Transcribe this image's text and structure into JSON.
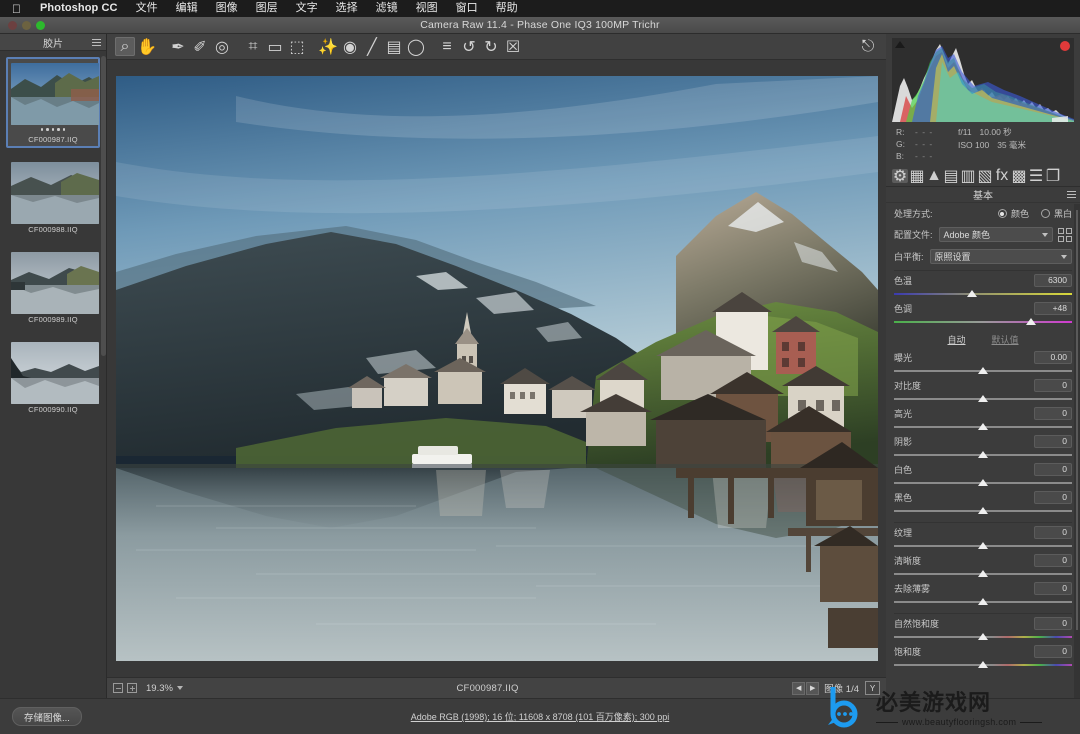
{
  "menubar": {
    "apple_icon": "apple-logo-icon",
    "app_name": "Photoshop CC",
    "items": [
      "文件",
      "编辑",
      "图像",
      "图层",
      "文字",
      "选择",
      "滤镜",
      "视图",
      "窗口",
      "帮助"
    ]
  },
  "window": {
    "title": "Camera Raw 11.4 -  Phase One IQ3 100MP Trichr"
  },
  "filmstrip": {
    "title": "胶片",
    "menu_icon": "filmstrip-menu-icon",
    "items": [
      {
        "name": "CF000987.IIQ",
        "selected": true,
        "stars": 5
      },
      {
        "name": "CF000988.IIQ",
        "selected": false,
        "stars": 0
      },
      {
        "name": "CF000989.IIQ",
        "selected": false,
        "stars": 0
      },
      {
        "name": "CF000990.IIQ",
        "selected": false,
        "stars": 0
      }
    ]
  },
  "toolbar": {
    "tools": [
      {
        "name": "zoom-tool",
        "glyph": "⌕",
        "active": true
      },
      {
        "name": "hand-tool",
        "glyph": "✋",
        "active": false
      },
      {
        "name": "white-balance-tool",
        "glyph": "✒",
        "active": false
      },
      {
        "name": "color-sampler-tool",
        "glyph": "✐",
        "active": false
      },
      {
        "name": "targeted-adjustment-tool",
        "glyph": "◎",
        "active": false
      },
      {
        "name": "crop-tool",
        "glyph": "⌗",
        "active": false
      },
      {
        "name": "straighten-tool",
        "glyph": "▭",
        "active": false
      },
      {
        "name": "transform-tool",
        "glyph": "⬚",
        "active": false
      },
      {
        "name": "spot-removal-tool",
        "glyph": "✨",
        "active": false
      },
      {
        "name": "red-eye-tool",
        "glyph": "◉",
        "active": false
      },
      {
        "name": "adjustment-brush-tool",
        "glyph": "╱",
        "active": false
      },
      {
        "name": "graduated-filter-tool",
        "glyph": "▤",
        "active": false
      },
      {
        "name": "radial-filter-tool",
        "glyph": "◯",
        "active": false
      },
      {
        "name": "preferences-tool",
        "glyph": "≡",
        "active": false
      },
      {
        "name": "rotate-ccw-tool",
        "glyph": "↺",
        "active": false
      },
      {
        "name": "rotate-cw-tool",
        "glyph": "↻",
        "active": false
      },
      {
        "name": "delete-tool",
        "glyph": "☒",
        "active": false
      }
    ],
    "fullscreen_icon": "fullscreen-toggle-icon"
  },
  "statusbar": {
    "zoom_level": "19.3%",
    "filename": "CF000987.IIQ",
    "prev_icon": "prev-image-icon",
    "next_icon": "next-image-icon",
    "image_count": "图像 1/4",
    "preview_toggle": "Y"
  },
  "histogram": {
    "shadow_clip_icon": "shadow-clipping-icon",
    "highlight_clip_icon": "highlight-clipping-icon",
    "readouts": [
      {
        "channel": "R:",
        "value": "- - -"
      },
      {
        "channel": "G:",
        "value": "- - -"
      },
      {
        "channel": "B:",
        "value": "- - -"
      }
    ],
    "exif": {
      "aperture": "f/11",
      "shutter": "10.00 秒",
      "iso": "ISO 100",
      "focal": "35 毫米"
    }
  },
  "panel_tabs": [
    {
      "name": "basic-tab",
      "glyph": "⚙",
      "active": true
    },
    {
      "name": "tone-curve-tab",
      "glyph": "▦",
      "active": false
    },
    {
      "name": "detail-tab",
      "glyph": "▲",
      "active": false
    },
    {
      "name": "hsl-adjustments-tab",
      "glyph": "▤",
      "active": false
    },
    {
      "name": "split-toning-tab",
      "glyph": "▥",
      "active": false
    },
    {
      "name": "lens-corrections-tab",
      "glyph": "▧",
      "active": false
    },
    {
      "name": "effects-tab",
      "glyph": "fx",
      "active": false
    },
    {
      "name": "calibration-tab",
      "glyph": "▩",
      "active": false
    },
    {
      "name": "presets-tab",
      "glyph": "☰",
      "active": false
    },
    {
      "name": "snapshots-tab",
      "glyph": "❐",
      "active": false
    }
  ],
  "basic_panel": {
    "title": "基本",
    "menu_icon": "panel-menu-icon",
    "treatment": {
      "label": "处理方式:",
      "color_option": "颜色",
      "bw_option": "黑白",
      "selected": "颜色"
    },
    "profile": {
      "label": "配置文件:",
      "value": "Adobe 颜色",
      "browse_icon": "profile-browser-icon"
    },
    "white_balance": {
      "label": "白平衡:",
      "value": "原照设置"
    },
    "wb_sliders": [
      {
        "label": "色温",
        "value": "6300",
        "pos": 44,
        "track": "temp"
      },
      {
        "label": "色调",
        "value": "+48",
        "pos": 77,
        "track": "tint"
      }
    ],
    "auto_label": "自动",
    "default_label": "默认值",
    "tone_sliders": [
      {
        "label": "曝光",
        "value": "0.00",
        "pos": 50,
        "track": "plain"
      },
      {
        "label": "对比度",
        "value": "0",
        "pos": 50,
        "track": "plain"
      },
      {
        "label": "高光",
        "value": "0",
        "pos": 50,
        "track": "plain"
      },
      {
        "label": "阴影",
        "value": "0",
        "pos": 50,
        "track": "plain"
      },
      {
        "label": "白色",
        "value": "0",
        "pos": 50,
        "track": "plain"
      },
      {
        "label": "黑色",
        "value": "0",
        "pos": 50,
        "track": "plain"
      }
    ],
    "presence_sliders": [
      {
        "label": "纹理",
        "value": "0",
        "pos": 50,
        "track": "plain"
      },
      {
        "label": "清晰度",
        "value": "0",
        "pos": 50,
        "track": "plain"
      },
      {
        "label": "去除薄雾",
        "value": "0",
        "pos": 50,
        "track": "plain"
      }
    ],
    "saturation_sliders": [
      {
        "label": "自然饱和度",
        "value": "0",
        "pos": 50,
        "track": "vib"
      },
      {
        "label": "饱和度",
        "value": "0",
        "pos": 50,
        "track": "vib"
      }
    ]
  },
  "bottombar": {
    "save_label": "存储图像...",
    "workflow_options": "Adobe RGB (1998); 16 位;  11608 x 8708 (101 百万像素);  300 ppi"
  },
  "watermark": {
    "logo_icon": "site-logo-icon",
    "site_name": "必美游戏网",
    "url": "www.beautyflooringsh.com"
  },
  "colors": {
    "accent_selected": "#5b7fb5",
    "panel_bg": "#3c3c3c",
    "clip_red": "#e03a3a"
  }
}
